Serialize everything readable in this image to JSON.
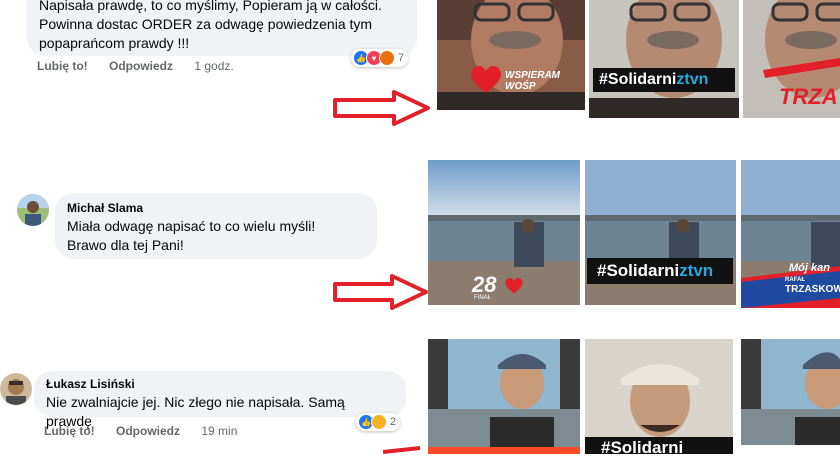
{
  "comments": [
    {
      "author": "",
      "text": "Napisała prawdę, to co myślimy, Popieram ją w całości. Powinna dostać ORDER za odwagę powiedzenia tym popaprańcom prawdy !!!",
      "line1": "Napisała prawdę, to co myślimy, Popieram ją w całości.",
      "line2": "Powinna dostac ORDER za odwagę powiedzenia tym",
      "line3": "popaprańcom prawdy !!!",
      "like": "Lubię to!",
      "reply": "Odpowiedz",
      "time": "1 godz.",
      "reactions": "7"
    },
    {
      "author": "Michał Slama",
      "line1": "Miała odwagę napisać to co wielu myśli!",
      "line2": "Brawo dla tej Pani!"
    },
    {
      "author": "Łukasz Lisiński",
      "line1": "Nie zwalniajcie jej. Nic złego nie napisała. Samą prawdę",
      "like": "Lubię to!",
      "reply": "Odpowiedz",
      "time": "19 min",
      "reactions": "2"
    }
  ],
  "photo_rows": [
    {
      "badges": {
        "wosp_heart": "wspieram",
        "wosp_text1": "WSPIERAM",
        "wosp_text2": "WOŚP",
        "solidarni": "#Solidarni",
        "tvn": "ztvn",
        "red_text": "TRZA"
      }
    },
    {
      "badges": {
        "wosp_number": "28",
        "wosp_small": "FINAŁ",
        "solidarni": "#Solidarni",
        "tvn": "ztvn",
        "kandydat1": "Mój kan",
        "kandydat2": "RAFAŁ",
        "kandydat3": "TRZASKOW"
      }
    },
    {
      "badges": {
        "solidarni": "#Solidarni"
      }
    }
  ],
  "colors": {
    "arrow": "#e3202a",
    "bubble": "#f0f2f5",
    "tvn_blue": "#2aa7e0",
    "like_blue": "#1877f2",
    "heart_red": "#f33e58",
    "haha_yellow": "#f7b125"
  },
  "icons": {
    "like": "thumbs-up-icon",
    "love": "heart-icon",
    "haha": "laughing-face-icon",
    "arrow": "red-arrow-icon"
  }
}
